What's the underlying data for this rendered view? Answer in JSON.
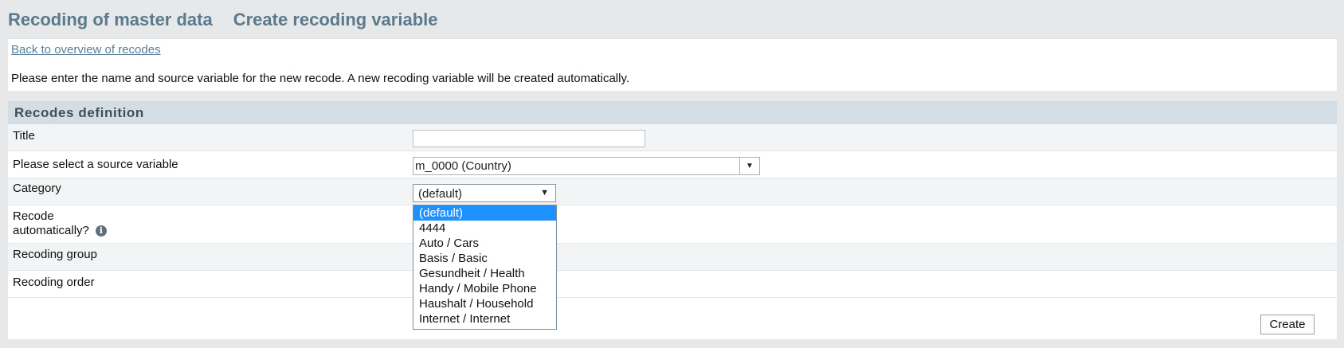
{
  "header": {
    "title": "Recoding of master data",
    "subtitle": "Create recoding variable"
  },
  "intro": {
    "back_link": "Back to overview of recodes",
    "text": "Please enter the name and source variable for the new recode. A new recoding variable will be created automatically."
  },
  "section": {
    "title": "Recodes definition",
    "rows": {
      "title_label": "Title",
      "title_value": "",
      "source_label": "Please select a source variable",
      "source_value": "m_0000 (Country)",
      "category_label": "Category",
      "category_value": "(default)",
      "recode_auto_label_1": "Recode",
      "recode_auto_label_2": "automatically?",
      "group_label": "Recoding group",
      "order_label": "Recoding order"
    }
  },
  "dropdown": {
    "options": [
      "(default)",
      "4444",
      "Auto / Cars",
      "Basis / Basic",
      "Gesundheit / Health",
      "Handy / Mobile Phone",
      "Haushalt / Household",
      "Internet / Internet"
    ],
    "selected_index": 0
  },
  "actions": {
    "create_label": "Create"
  },
  "icons": {
    "info": "info-icon",
    "combo_arrow": "chevron-down-icon",
    "select_arrow": "triangle-down-icon"
  }
}
